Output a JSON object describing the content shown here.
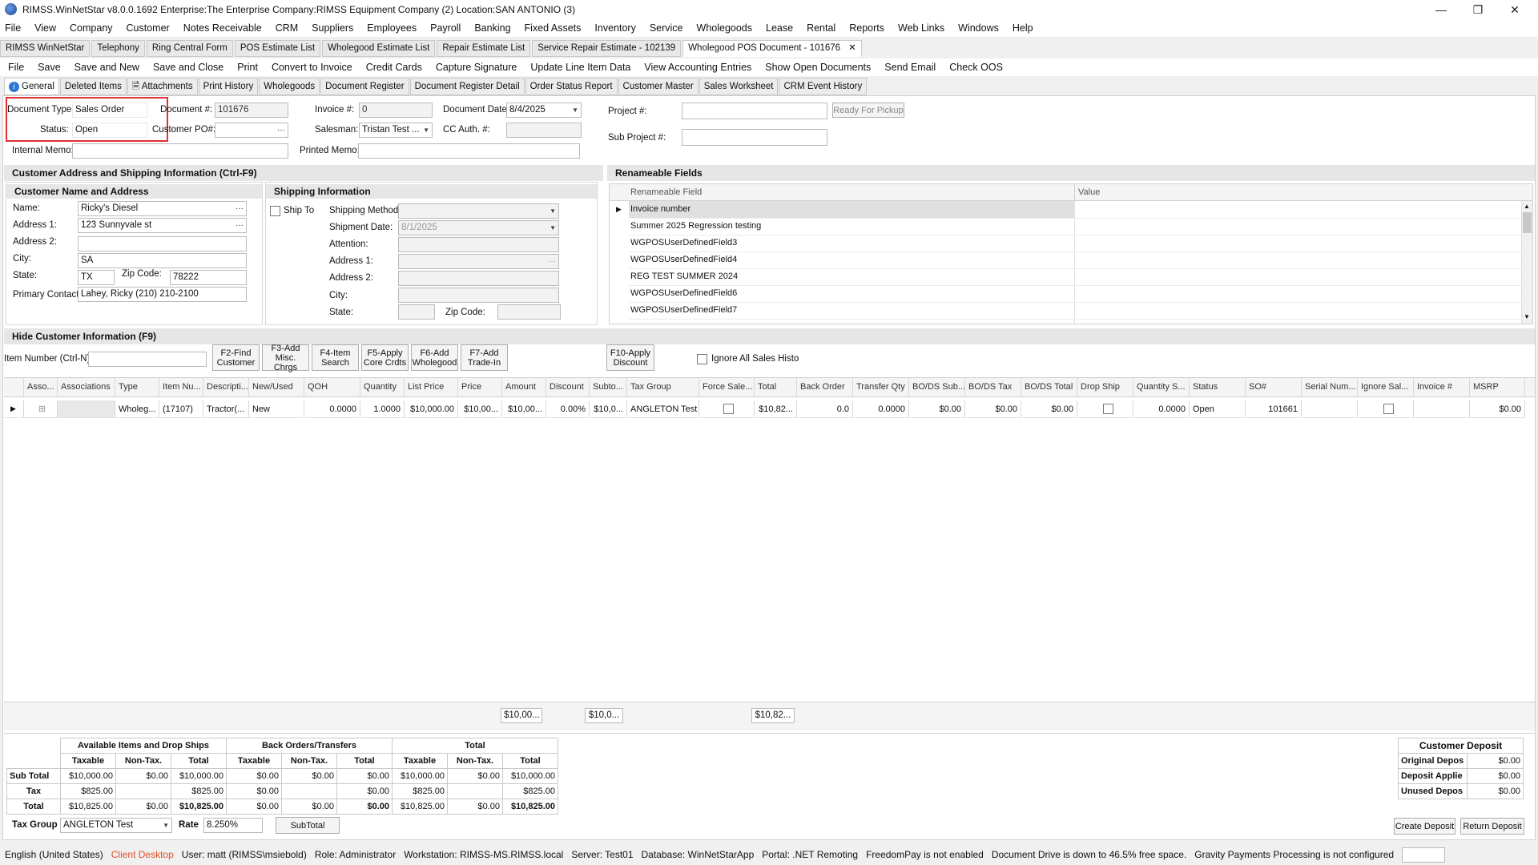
{
  "window": {
    "title": "RIMSS.WinNetStar v8.0.0.1692   Enterprise:The Enterprise  Company:RIMSS Equipment Company (2)  Location:SAN ANTONIO (3)"
  },
  "menu": [
    "File",
    "View",
    "Company",
    "Customer",
    "Notes Receivable",
    "CRM",
    "Suppliers",
    "Employees",
    "Payroll",
    "Banking",
    "Fixed Assets",
    "Inventory",
    "Service",
    "Wholegoods",
    "Lease",
    "Rental",
    "Reports",
    "Web Links",
    "Windows",
    "Help"
  ],
  "tabs": [
    "RIMSS WinNetStar",
    "Telephony",
    "Ring Central Form",
    "POS Estimate List",
    "Wholegood Estimate List",
    "Repair Estimate List",
    "Service Repair Estimate - 102139",
    "Wholegood POS Document - 101676"
  ],
  "toolbar": [
    "File",
    "Save",
    "Save and New",
    "Save and Close",
    "Print",
    "Convert to Invoice",
    "Credit Cards",
    "Capture Signature",
    "Update Line Item Data",
    "View Accounting Entries",
    "Show Open Documents",
    "Send Email",
    "Check OOS"
  ],
  "subtabs": [
    "General",
    "Deleted Items",
    "Attachments",
    "Print History",
    "Wholegoods",
    "Document Register",
    "Document Register Detail",
    "Order Status Report",
    "Customer Master",
    "Sales Worksheet",
    "CRM Event History"
  ],
  "header": {
    "doc_type_label": "Document Type:",
    "doc_type": "Sales Order",
    "status_label": "Status:",
    "status": "Open",
    "doc_num_label": "Document #:",
    "doc_num": "101676",
    "cust_po_label": "Customer PO#:",
    "cust_po": "",
    "invoice_label": "Invoice #:",
    "invoice": "0",
    "salesman_label": "Salesman:",
    "salesman": "Tristan Test ...",
    "doc_date_label": "Document Date:",
    "doc_date": "8/4/2025",
    "cc_auth_label": "CC Auth. #:",
    "cc_auth": "",
    "project_label": "Project #:",
    "project": "",
    "sub_project_label": "Sub Project #:",
    "sub_project": "",
    "ready_btn": "Ready For Pickup",
    "internal_memo_label": "Internal Memo:",
    "internal_memo": "",
    "printed_memo_label": "Printed Memo:",
    "printed_memo": ""
  },
  "customer_section": {
    "title": "Customer Address and Shipping Information (Ctrl-F9)",
    "name_addr_title": "Customer Name and Address",
    "name_label": "Name:",
    "name": "Ricky's Diesel",
    "addr1_label": "Address 1:",
    "addr1": "123 Sunnyvale st",
    "addr2_label": "Address 2:",
    "addr2": "",
    "city_label": "City:",
    "city": "SA",
    "state_label": "State:",
    "state": "TX",
    "zip_label": "Zip Code:",
    "zip": "78222",
    "contact_label": "Primary Contact:",
    "contact": "Lahey, Ricky (210) 210-2100"
  },
  "shipping": {
    "title": "Shipping Information",
    "ship_to": "Ship To",
    "method_label": "Shipping Method:",
    "date_label": "Shipment Date:",
    "date": "8/1/2025",
    "attention_label": "Attention:",
    "addr1_label": "Address 1:",
    "addr2_label": "Address 2:",
    "city_label": "City:",
    "state_label": "State:",
    "zip_label": "Zip Code:"
  },
  "renameable": {
    "title": "Renameable Fields",
    "col1": "Renameable Field",
    "col2": "Value",
    "rows": [
      "Invoice number",
      "Summer 2025 Regression testing",
      "WGPOSUserDefinedField3",
      "WGPOSUserDefinedField4",
      "REG TEST SUMMER 2024",
      "WGPOSUserDefinedField6",
      "WGPOSUserDefinedField7"
    ]
  },
  "hide_customer": "Hide Customer Information (F9)",
  "item_entry": {
    "label": "Item Number (Ctrl-N):",
    "buttons": [
      [
        "F2-Find",
        "Customer"
      ],
      [
        "F3-Add",
        "Misc. Chrgs"
      ],
      [
        "F4-Item",
        "Search"
      ],
      [
        "F5-Apply",
        "Core Crdts"
      ],
      [
        "F6-Add",
        "Wholegood"
      ],
      [
        "F7-Add",
        "Trade-In"
      ]
    ],
    "discount_btn": [
      "F10-Apply",
      "Discount"
    ],
    "ignore_label": "Ignore All Sales History"
  },
  "grid": {
    "headers": [
      "Asso...",
      "Associations",
      "Type",
      "Item Nu...",
      "Descripti...",
      "New/Used",
      "QOH",
      "Quantity",
      "List Price",
      "Price",
      "Amount",
      "Discount",
      "Subto...",
      "Tax Group",
      "Force Sale...",
      "Total",
      "Back Order",
      "Transfer Qty",
      "BO/DS Sub...",
      "BO/DS Tax",
      "BO/DS Total",
      "Drop Ship",
      "Quantity S...",
      "Status",
      "SO#",
      "Serial Num...",
      "Ignore Sal...",
      "Invoice #",
      "MSRP"
    ],
    "row": [
      "",
      "",
      "Wholeg...",
      "(17107)",
      "Tractor(...",
      "New",
      "0.0000",
      "1.0000",
      "$10,000.00",
      "$10,00...",
      "$10,00...",
      "0.00%",
      "$10,0...",
      "ANGLETON Test",
      "",
      "$10,82...",
      "0.0",
      "0.0000",
      "$0.00",
      "$0.00",
      "$0.00",
      "",
      "0.0000",
      "Open",
      "101661",
      "",
      "",
      "",
      "$0.00"
    ],
    "footer": [
      "$10,00...",
      "$10,0...",
      "$10,82..."
    ]
  },
  "totals": {
    "groups": [
      "Available Items and Drop Ships",
      "Back Orders/Transfers",
      "Total"
    ],
    "cols": [
      "Taxable",
      "Non-Tax.",
      "Total"
    ],
    "rows": [
      {
        "label": "Sub Total",
        "v": [
          "$10,000.00",
          "$0.00",
          "$10,000.00",
          "$0.00",
          "$0.00",
          "$0.00",
          "$10,000.00",
          "$0.00",
          "$10,000.00"
        ]
      },
      {
        "label": "Tax",
        "v": [
          "$825.00",
          "",
          "$825.00",
          "$0.00",
          "",
          "$0.00",
          "$825.00",
          "",
          "$825.00"
        ]
      },
      {
        "label": "Total",
        "v": [
          "$10,825.00",
          "$0.00",
          "$10,825.00",
          "$0.00",
          "$0.00",
          "$0.00",
          "$10,825.00",
          "$0.00",
          "$10,825.00"
        ]
      }
    ],
    "tax_group_label": "Tax Group",
    "tax_group": "ANGLETON Test",
    "rate_label": "Rate",
    "rate": "8.250%",
    "subtotal_btn": "SubTotal"
  },
  "deposit": {
    "title": "Customer Deposit",
    "rows": [
      {
        "label": "Original Depos",
        "value": "$0.00"
      },
      {
        "label": "Deposit Applie",
        "value": "$0.00"
      },
      {
        "label": "Unused Depos",
        "value": "$0.00"
      }
    ],
    "create_btn": "Create Deposit",
    "return_btn": "Return Deposit"
  },
  "status": {
    "lang": "English (United States)",
    "client": "Client Desktop",
    "user": "User: matt (RIMSS\\msiebold)",
    "role": "Role: Administrator",
    "workstation": "Workstation: RIMSS-MS.RIMSS.local",
    "server": "Server: Test01",
    "database": "Database: WinNetStarApp",
    "portal": "Portal: .NET Remoting",
    "freedompay": "FreedomPay is not enabled",
    "drive": "Document Drive is down to 46.5% free space.",
    "gravity": "Gravity Payments Processing is not configured",
    "client_color": "#e0502a"
  }
}
